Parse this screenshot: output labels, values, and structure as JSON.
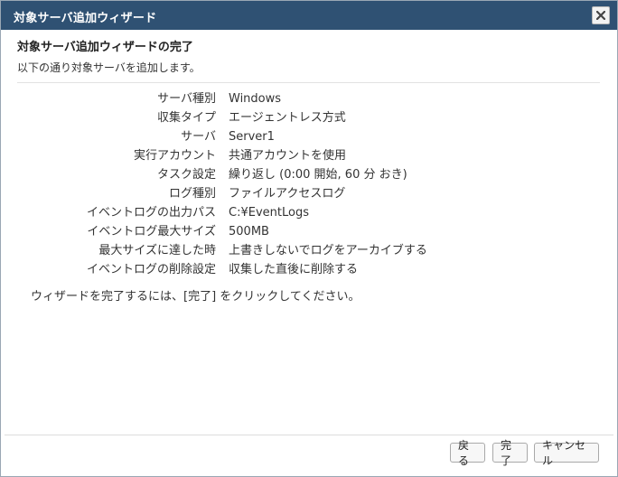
{
  "window": {
    "title": "対象サーバ追加ウィザード"
  },
  "page": {
    "heading": "対象サーバ追加ウィザードの完了",
    "description": "以下の通り対象サーバを追加します。",
    "finish_note": "ウィザードを完了するには、[完了] をクリックしてください。"
  },
  "summary": [
    {
      "label": "サーバ種別",
      "value": "Windows"
    },
    {
      "label": "収集タイプ",
      "value": "エージェントレス方式"
    },
    {
      "label": "サーバ",
      "value": "Server1"
    },
    {
      "label": "実行アカウント",
      "value": "共通アカウントを使用"
    },
    {
      "label": "タスク設定",
      "value": "繰り返し (0:00 開始, 60 分 おき)"
    },
    {
      "label": "ログ種別",
      "value": "ファイルアクセスログ"
    },
    {
      "label": "イベントログの出力パス",
      "value": "C:¥EventLogs"
    },
    {
      "label": "イベントログ最大サイズ",
      "value": "500MB"
    },
    {
      "label": "最大サイズに達した時",
      "value": "上書きしないでログをアーカイブする"
    },
    {
      "label": "イベントログの削除設定",
      "value": "収集した直後に削除する"
    }
  ],
  "buttons": {
    "back": "戻る",
    "finish": "完了",
    "cancel": "キャンセル"
  },
  "icons": {
    "close": "close-icon"
  },
  "colors": {
    "titlebar": "#2f5173"
  }
}
